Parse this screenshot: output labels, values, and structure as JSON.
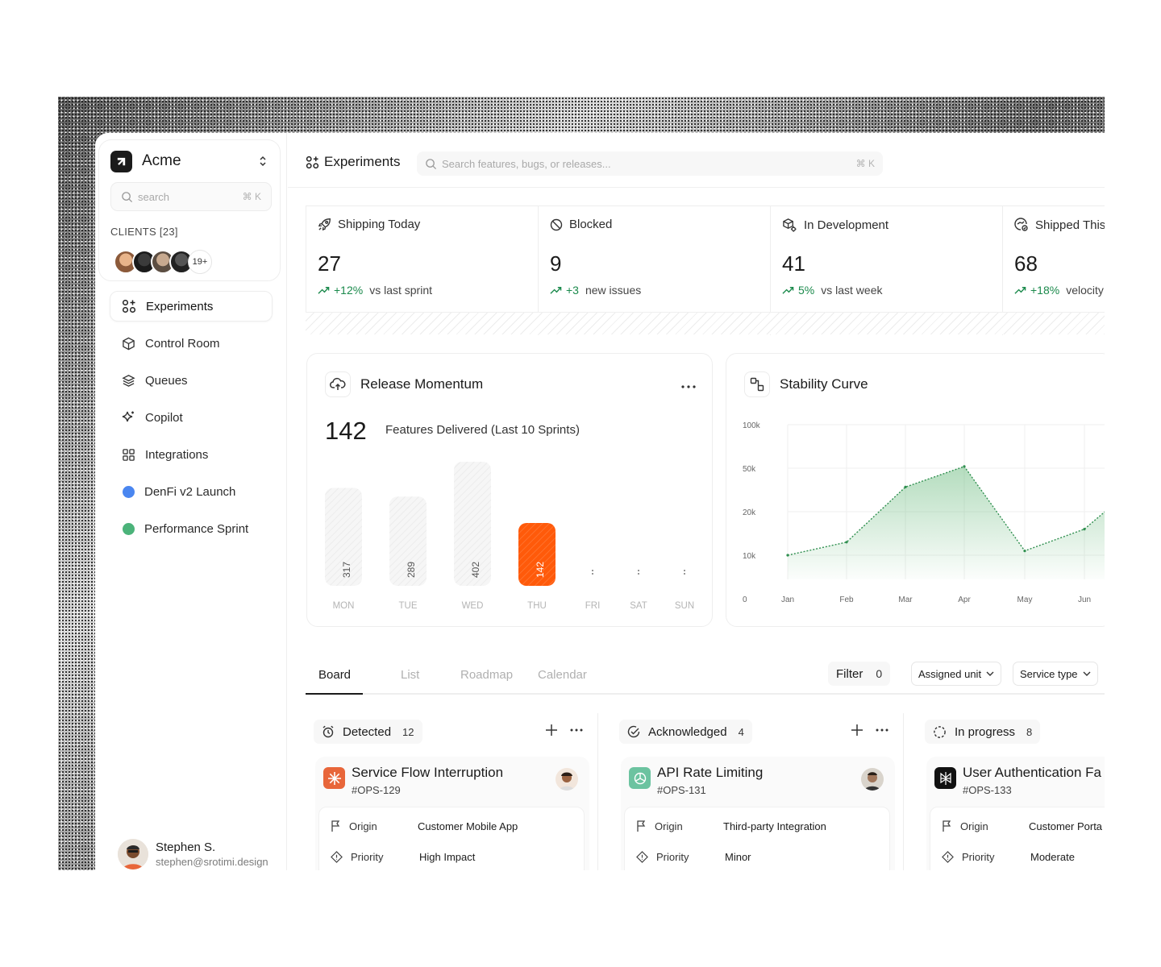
{
  "brand": {
    "name": "Acme"
  },
  "sidebar": {
    "search": {
      "placeholder": "search",
      "shortcut": "⌘ K"
    },
    "clients_label": "CLIENTS [23]",
    "clients_more": "19+",
    "nav": [
      {
        "label": "Experiments",
        "icon": "experiments-icon",
        "active": true
      },
      {
        "label": "Control Room",
        "icon": "cube-icon"
      },
      {
        "label": "Queues",
        "icon": "layers-icon"
      },
      {
        "label": "Copilot",
        "icon": "sparkle-icon"
      },
      {
        "label": "Integrations",
        "icon": "grid-icon"
      },
      {
        "label": "DenFi v2 Launch",
        "icon": "dot",
        "color": "#4a86f0"
      },
      {
        "label": "Performance Sprint",
        "icon": "dot",
        "color": "#4bb37a"
      }
    ],
    "user": {
      "name": "Stephen S.",
      "email": "stephen@srotimi.design"
    }
  },
  "topbar": {
    "title": "Experiments",
    "search": {
      "placeholder": "Search features, bugs, or releases...",
      "shortcut": "⌘ K"
    }
  },
  "stats": [
    {
      "title": "Shipping Today",
      "value": "27",
      "delta": "+12%",
      "delta_text": "vs last sprint",
      "icon": "rocket-icon"
    },
    {
      "title": "Blocked",
      "value": "9",
      "delta": "+3",
      "delta_text": "new issues",
      "icon": "blocked-icon"
    },
    {
      "title": "In Development",
      "value": "41",
      "delta": "5%",
      "delta_text": "vs last week",
      "icon": "dev-gear-icon"
    },
    {
      "title": "Shipped This",
      "value": "68",
      "delta": "+18%",
      "delta_text": "velocity",
      "icon": "shipped-icon"
    }
  ],
  "momentum": {
    "title": "Release Momentum",
    "total": "142",
    "caption": "Features Delivered (Last 10 Sprints)"
  },
  "stability": {
    "title": "Stability Curve"
  },
  "chart_data": [
    {
      "type": "bar",
      "categories": [
        "MON",
        "TUE",
        "WED",
        "THU",
        "FRI",
        "SAT",
        "SUN"
      ],
      "values": [
        317,
        289,
        402,
        142,
        0,
        0,
        0
      ],
      "labels": [
        "317",
        "289",
        "402",
        "142",
        "",
        "",
        ""
      ],
      "highlight_index": 3,
      "highlight_color": "#ff5a0a",
      "ylim": [
        0,
        402
      ]
    },
    {
      "type": "area",
      "x": [
        "Jan",
        "Feb",
        "Mar",
        "Apr",
        "May",
        "Jun"
      ],
      "yticks": [
        "100k",
        "50k",
        "20k",
        "10k",
        "0"
      ],
      "values": [
        10000,
        13000,
        37000,
        52000,
        11000,
        16000
      ],
      "end_value": 25000,
      "color": "#2f8f4f",
      "scale": "nonlinear"
    }
  ],
  "board": {
    "tabs": [
      "Board",
      "List",
      "Roadmap",
      "Calendar"
    ],
    "active_tab": "Board",
    "filter_label": "Filter",
    "filter_count": "0",
    "dropdowns": [
      "Assigned unit",
      "Service type"
    ],
    "columns": [
      {
        "title": "Detected",
        "count": "12",
        "icon": "alarm-icon",
        "card": {
          "title": "Service Flow Interruption",
          "id": "#OPS-129",
          "logo_color": "#e8663a",
          "origin_label": "Origin",
          "origin": "Customer Mobile App",
          "priority_label": "Priority",
          "priority": "High Impact"
        }
      },
      {
        "title": "Acknowledged",
        "count": "4",
        "icon": "check-circle-icon",
        "card": {
          "title": "API Rate Limiting",
          "id": "#OPS-131",
          "logo_color": "#6cc3a0",
          "origin_label": "Origin",
          "origin": "Third-party Integration",
          "priority_label": "Priority",
          "priority": "Minor"
        }
      },
      {
        "title": "In progress",
        "count": "8",
        "icon": "progress-icon",
        "card": {
          "title": "User Authentication Fa",
          "id": "#OPS-133",
          "logo_color": "#111111",
          "origin_label": "Origin",
          "origin": "Customer Porta",
          "priority_label": "Priority",
          "priority": "Moderate"
        }
      }
    ]
  }
}
